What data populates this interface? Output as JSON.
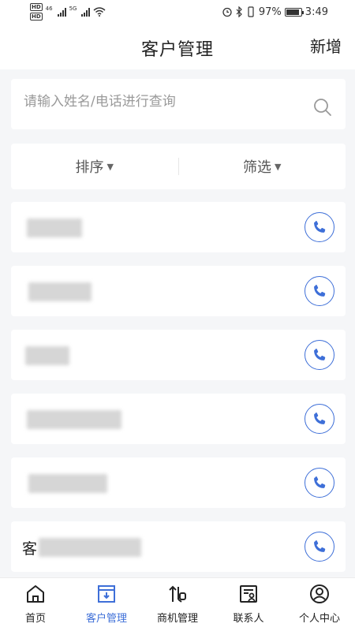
{
  "status_bar": {
    "battery": "97%",
    "time": "3:49",
    "network_a": "46",
    "network_b": "5G"
  },
  "header": {
    "title": "客户管理",
    "add_label": "新增"
  },
  "search": {
    "placeholder": "请输入姓名/电话进行查询",
    "value": ""
  },
  "filters": {
    "sort_label": "排序",
    "filter_label": "筛选"
  },
  "customers": [
    {
      "name": ""
    },
    {
      "name": ""
    },
    {
      "name": ""
    },
    {
      "name": ""
    },
    {
      "name": ""
    },
    {
      "name": "客"
    }
  ],
  "bottom_nav": [
    {
      "label": "首页",
      "icon": "home-icon",
      "active": false
    },
    {
      "label": "客户管理",
      "icon": "customer-board-icon",
      "active": true
    },
    {
      "label": "商机管理",
      "icon": "opportunity-icon",
      "active": false
    },
    {
      "label": "联系人",
      "icon": "contact-card-icon",
      "active": false
    },
    {
      "label": "个人中心",
      "icon": "user-circle-icon",
      "active": false
    }
  ],
  "colors": {
    "accent": "#3e6fd8",
    "background": "#f5f6f8"
  }
}
